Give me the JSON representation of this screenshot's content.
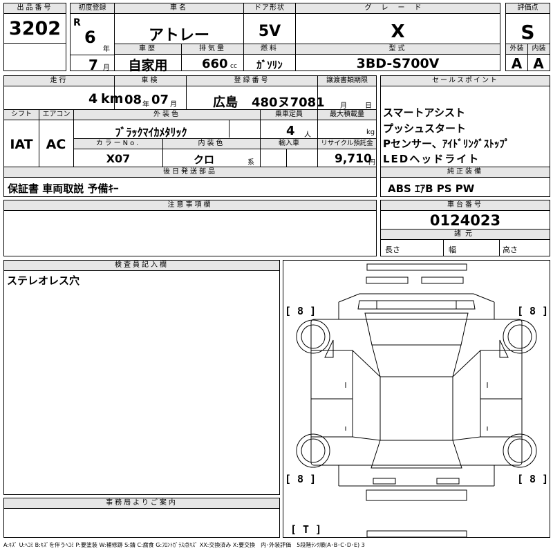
{
  "lot": {
    "header": "出品番号",
    "value": "3202"
  },
  "first_reg": {
    "header": "初度登録",
    "era": "R",
    "year": "6",
    "year_unit": "年",
    "month": "7",
    "month_unit": "月"
  },
  "car_name": {
    "header": "車名",
    "value": "アトレー"
  },
  "door": {
    "header": "ドア形状",
    "value": "5V"
  },
  "grade": {
    "header": "グレード",
    "value": "X"
  },
  "score": {
    "header": "評価点",
    "value": "S"
  },
  "history": {
    "header": "車歴",
    "value": "自家用"
  },
  "displacement": {
    "header": "排気量",
    "value": "660",
    "unit": "cc"
  },
  "fuel": {
    "header": "燃料",
    "value": "ｶﾞｿﾘﾝ"
  },
  "model_code": {
    "header": "型式",
    "value": "3BD-S700V"
  },
  "ext_grade": {
    "header": "外装",
    "value": "A"
  },
  "int_grade": {
    "header": "内装",
    "value": "A"
  },
  "mileage": {
    "header": "走行",
    "value": "4",
    "unit": "km"
  },
  "inspection": {
    "header": "車検",
    "year": "08",
    "year_unit": "年",
    "month": "07",
    "month_unit": "月"
  },
  "registration": {
    "header": "登録番号",
    "area": "広島",
    "number": "480ヌ7081"
  },
  "transfer_doc": {
    "header": "譲渡書類期限",
    "month_unit": "月",
    "day_unit": "日"
  },
  "sales_point": {
    "header": "セールスポイント",
    "items": [
      "スマートアシスト",
      "プッシュスタート",
      "Pセンサー、ｱｲﾄﾞﾘﾝｸﾞｽﾄｯﾌﾟ",
      "LEDヘッドライト"
    ]
  },
  "shift": {
    "header": "シフト",
    "value": "IAT"
  },
  "aircon": {
    "header": "エアコン",
    "value": "AC"
  },
  "ext_color": {
    "header": "外装色",
    "value": "ﾌﾞﾗｯｸﾏｲｶﾒﾀﾘｯｸ"
  },
  "capacity": {
    "header": "乗車定員",
    "value": "4",
    "unit": "人"
  },
  "max_load": {
    "header": "最大積載量",
    "value": "",
    "unit": "kg"
  },
  "color_no": {
    "header": "カラーNo.",
    "value": "X07"
  },
  "int_color": {
    "header": "内装色",
    "value": "クロ",
    "suffix": "系"
  },
  "import": {
    "header": "輸入車",
    "value": ""
  },
  "recycle": {
    "header": "リサイクル預託金",
    "value": "9,710",
    "unit": "円"
  },
  "accessories": {
    "header": "後日発送部品",
    "value": "保証書 車両取説 予備ｷｰ"
  },
  "genuine_equip": {
    "header": "純正装備",
    "value": "ABS ｴｱB PS PW"
  },
  "notes": {
    "header": "注意事項欄",
    "value": ""
  },
  "chassis": {
    "header": "車台番号",
    "value": "0124023"
  },
  "dims": {
    "header": "諸元",
    "length": "長さ",
    "width": "幅",
    "height": "高さ"
  },
  "inspector": {
    "header": "検査員記入欄",
    "value": "ステレオレス穴"
  },
  "office": {
    "header": "事務局よりご案内",
    "value": ""
  },
  "diagram": {
    "tl": "[ 8 ]",
    "tr": "[ 8 ]",
    "bl": "[ 8 ]",
    "br": "[ 8 ]",
    "bottom": "[ T ]"
  },
  "legend": "A:ｷｽﾞ U:ﾍｺﾐ B:ｷｽﾞを伴うﾍｺﾐ P:要塗装 W:補修跡 S:錆 C:腐食 G:ﾌﾛﾝﾄｶﾞﾗｽ点ｷｽﾞ XX:交換済み X:要交換　内･外装評価　5段階ﾗﾝｸ順(A･B･C･D･E) 3"
}
